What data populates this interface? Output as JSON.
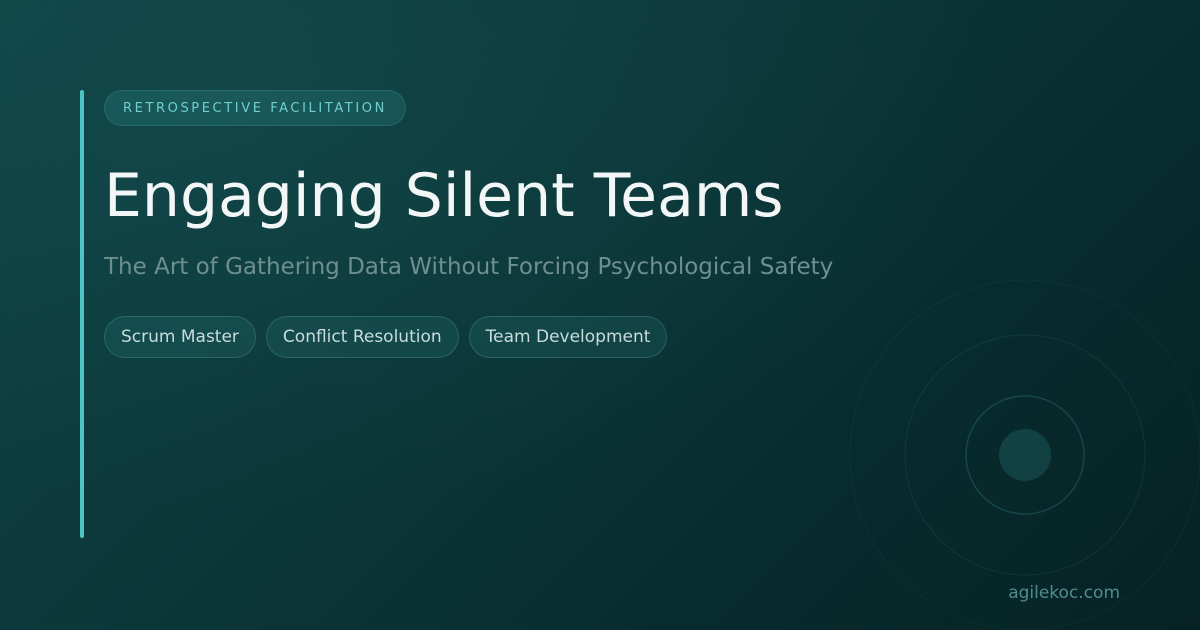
{
  "eyebrow": "RETROSPECTIVE FACILITATION",
  "title": "Engaging Silent Teams",
  "subtitle": "The Art of Gathering Data Without Forcing Psychological Safety",
  "tags": [
    "Scrum Master",
    "Conflict Resolution",
    "Team Development"
  ],
  "footer": {
    "url": "agilekoc.com"
  },
  "colors": {
    "background": "#0b3638",
    "accent": "#4fc4c4",
    "title": "#f2f6f6",
    "subtitle": "#6f8f8f",
    "url": "#4f8c8c"
  },
  "icons": {
    "decoration": "concentric-rings-icon"
  }
}
